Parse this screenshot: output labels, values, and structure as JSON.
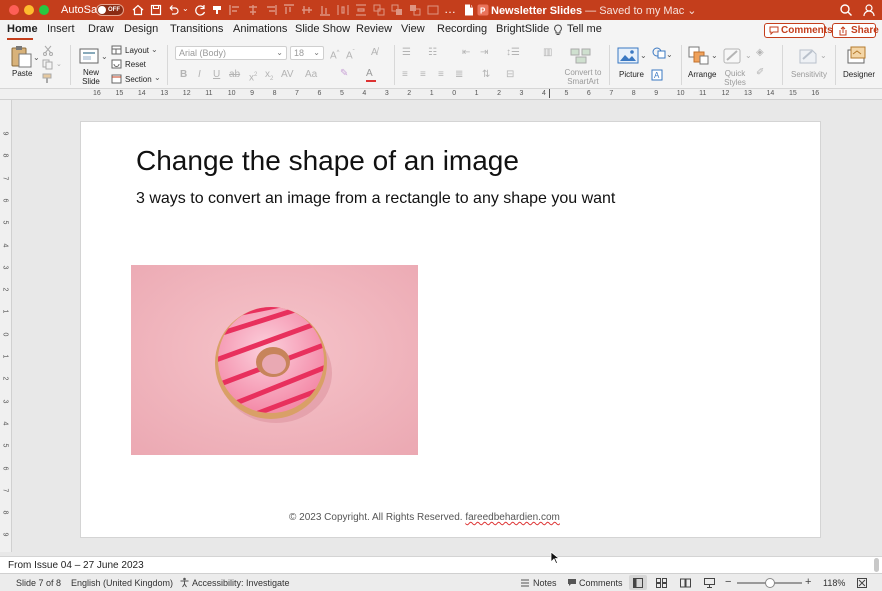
{
  "titlebar": {
    "autosave_label": "AutoSave",
    "autosave_state": "OFF",
    "doc_name": "Newsletter Slides",
    "doc_status": "— Saved to my Mac ⌄"
  },
  "tabs": [
    "Home",
    "Insert",
    "Draw",
    "Design",
    "Transitions",
    "Animations",
    "Slide Show",
    "Review",
    "View",
    "Recording",
    "BrightSlide"
  ],
  "tell_me": "Tell me",
  "comments_label": "Comments",
  "share_label": "Share",
  "ribbon": {
    "paste": "Paste",
    "new_slide": "New Slide",
    "layout": "Layout",
    "reset": "Reset",
    "section": "Section",
    "font_name": "Arial (Body)",
    "font_size": "18",
    "convert_smartart": "Convert to SmartArt",
    "picture": "Picture",
    "arrange": "Arrange",
    "quick_styles": "Quick Styles",
    "sensitivity": "Sensitivity",
    "designer": "Designer"
  },
  "slide": {
    "title": "Change the shape of an image",
    "subtitle": "3 ways to convert an image from a rectangle to any shape you want",
    "footer_text": "© 2023 Copyright. All Rights Reserved. ",
    "footer_link": "fareedbehardien.com"
  },
  "notes_text": "From Issue 04 – 27 June 2023",
  "status": {
    "slide_counter": "Slide 7 of 8",
    "language": "English (United Kingdom)",
    "accessibility": "Accessibility: Investigate",
    "notes": "Notes",
    "comments": "Comments",
    "zoom": "118%"
  },
  "ruler": {
    "horizontal": [
      "16",
      "15",
      "14",
      "13",
      "12",
      "11",
      "10",
      "9",
      "8",
      "7",
      "6",
      "5",
      "4",
      "3",
      "2",
      "1",
      "0",
      "1",
      "2",
      "3",
      "4",
      "5",
      "6",
      "7",
      "8",
      "9",
      "10",
      "11",
      "12",
      "13",
      "14",
      "15",
      "16"
    ],
    "vertical": [
      "9",
      "8",
      "7",
      "6",
      "5",
      "4",
      "3",
      "2",
      "1",
      "0",
      "1",
      "2",
      "3",
      "4",
      "5",
      "6",
      "7",
      "8",
      "9"
    ]
  },
  "colors": {
    "accent": "#c43e1c",
    "image_bg": "#f2b8c0",
    "donut_icing": "#f6a6b8",
    "donut_drizzle": "#e8305d"
  }
}
